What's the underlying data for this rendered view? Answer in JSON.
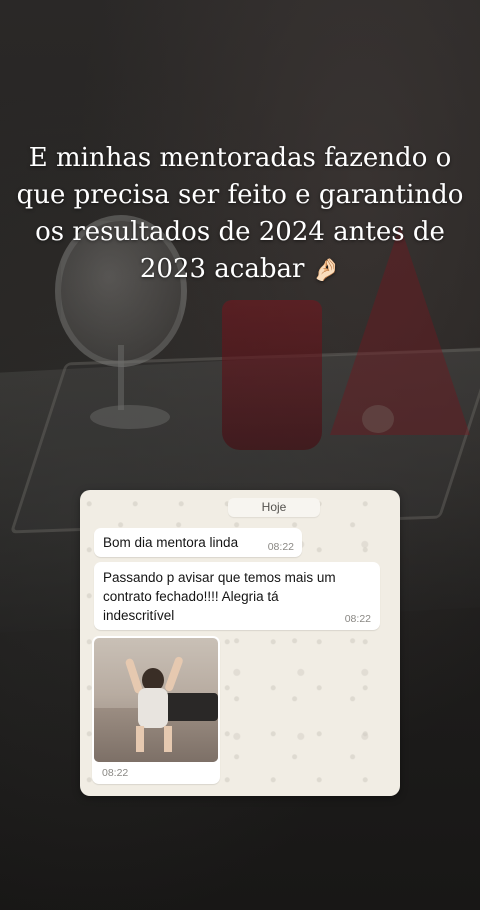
{
  "caption": {
    "text": "E minhas mentoradas fazendo o que precisa ser feito e garantindo os resultados de 2024 antes de 2023 acabar",
    "emoji": "🤌🏻"
  },
  "chat": {
    "date_chip": "Hoje",
    "messages": [
      {
        "text": "Bom dia mentora linda",
        "time": "08:22"
      },
      {
        "text": "Passando p avisar que temos mais um contrato fechado!!!! Alegria tá indescritível",
        "time": "08:22"
      },
      {
        "type": "image",
        "time": "08:22"
      }
    ]
  },
  "colors": {
    "chat_background": "#f1ede4",
    "bubble_background": "#ffffff",
    "time_text": "#8a8884"
  }
}
